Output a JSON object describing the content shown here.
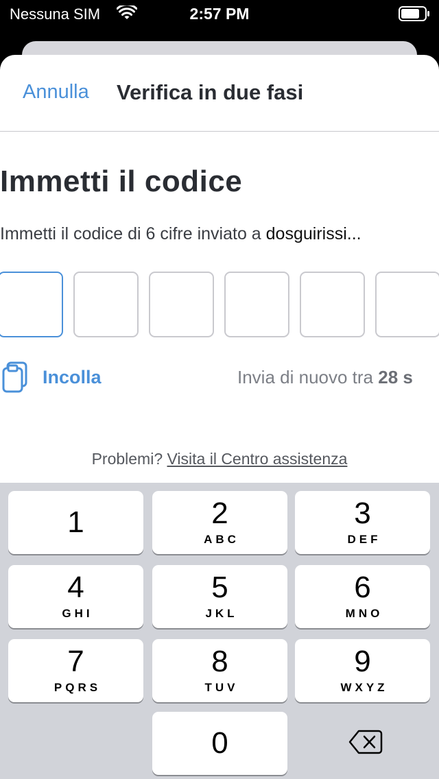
{
  "status_bar": {
    "carrier": "Nessuna SIM",
    "time": "2:57 PM"
  },
  "nav": {
    "cancel_label": "Annulla",
    "title": "Verifica in due fasi"
  },
  "content": {
    "heading": "Immetti il codice",
    "instructions_prefix": "Immetti il codice di 6 cifre inviato a ",
    "instructions_email": "dosguirissi...",
    "code_digits": [
      "",
      "",
      "",
      "",
      "",
      ""
    ],
    "paste_label": "Incolla",
    "resend_prefix": "Invia di nuovo tra ",
    "resend_seconds": "28 s",
    "help_prefix": "Problemi?",
    "help_link": "Visita il Centro assistenza"
  },
  "keyboard": {
    "keys": [
      {
        "num": "1",
        "letters": ""
      },
      {
        "num": "2",
        "letters": "ABC"
      },
      {
        "num": "3",
        "letters": "DEF"
      },
      {
        "num": "4",
        "letters": "GHI"
      },
      {
        "num": "5",
        "letters": "JKL"
      },
      {
        "num": "6",
        "letters": "MNO"
      },
      {
        "num": "7",
        "letters": "PQRS"
      },
      {
        "num": "8",
        "letters": "TUV"
      },
      {
        "num": "9",
        "letters": "WXYZ"
      },
      {
        "num": "0",
        "letters": ""
      }
    ]
  },
  "colors": {
    "accent": "#4a90d9",
    "text": "#2a2d33",
    "keyboard_bg": "#d1d3d9"
  },
  "icons": [
    "wifi-icon",
    "battery-icon",
    "clipboard-icon",
    "delete-icon"
  ]
}
